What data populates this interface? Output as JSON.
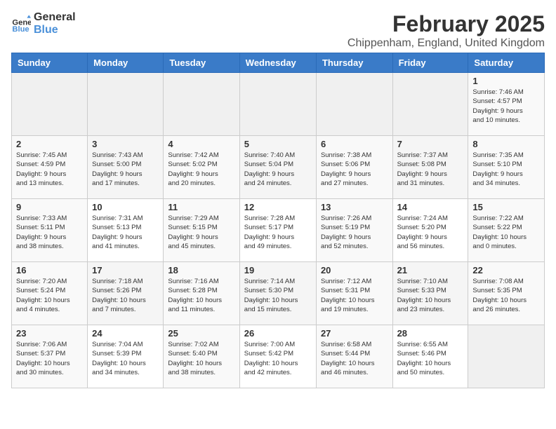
{
  "header": {
    "logo_line1": "General",
    "logo_line2": "Blue",
    "month_year": "February 2025",
    "location": "Chippenham, England, United Kingdom"
  },
  "weekdays": [
    "Sunday",
    "Monday",
    "Tuesday",
    "Wednesday",
    "Thursday",
    "Friday",
    "Saturday"
  ],
  "weeks": [
    [
      {
        "day": "",
        "info": ""
      },
      {
        "day": "",
        "info": ""
      },
      {
        "day": "",
        "info": ""
      },
      {
        "day": "",
        "info": ""
      },
      {
        "day": "",
        "info": ""
      },
      {
        "day": "",
        "info": ""
      },
      {
        "day": "1",
        "info": "Sunrise: 7:46 AM\nSunset: 4:57 PM\nDaylight: 9 hours\nand 10 minutes."
      }
    ],
    [
      {
        "day": "2",
        "info": "Sunrise: 7:45 AM\nSunset: 4:59 PM\nDaylight: 9 hours\nand 13 minutes."
      },
      {
        "day": "3",
        "info": "Sunrise: 7:43 AM\nSunset: 5:00 PM\nDaylight: 9 hours\nand 17 minutes."
      },
      {
        "day": "4",
        "info": "Sunrise: 7:42 AM\nSunset: 5:02 PM\nDaylight: 9 hours\nand 20 minutes."
      },
      {
        "day": "5",
        "info": "Sunrise: 7:40 AM\nSunset: 5:04 PM\nDaylight: 9 hours\nand 24 minutes."
      },
      {
        "day": "6",
        "info": "Sunrise: 7:38 AM\nSunset: 5:06 PM\nDaylight: 9 hours\nand 27 minutes."
      },
      {
        "day": "7",
        "info": "Sunrise: 7:37 AM\nSunset: 5:08 PM\nDaylight: 9 hours\nand 31 minutes."
      },
      {
        "day": "8",
        "info": "Sunrise: 7:35 AM\nSunset: 5:10 PM\nDaylight: 9 hours\nand 34 minutes."
      }
    ],
    [
      {
        "day": "9",
        "info": "Sunrise: 7:33 AM\nSunset: 5:11 PM\nDaylight: 9 hours\nand 38 minutes."
      },
      {
        "day": "10",
        "info": "Sunrise: 7:31 AM\nSunset: 5:13 PM\nDaylight: 9 hours\nand 41 minutes."
      },
      {
        "day": "11",
        "info": "Sunrise: 7:29 AM\nSunset: 5:15 PM\nDaylight: 9 hours\nand 45 minutes."
      },
      {
        "day": "12",
        "info": "Sunrise: 7:28 AM\nSunset: 5:17 PM\nDaylight: 9 hours\nand 49 minutes."
      },
      {
        "day": "13",
        "info": "Sunrise: 7:26 AM\nSunset: 5:19 PM\nDaylight: 9 hours\nand 52 minutes."
      },
      {
        "day": "14",
        "info": "Sunrise: 7:24 AM\nSunset: 5:20 PM\nDaylight: 9 hours\nand 56 minutes."
      },
      {
        "day": "15",
        "info": "Sunrise: 7:22 AM\nSunset: 5:22 PM\nDaylight: 10 hours\nand 0 minutes."
      }
    ],
    [
      {
        "day": "16",
        "info": "Sunrise: 7:20 AM\nSunset: 5:24 PM\nDaylight: 10 hours\nand 4 minutes."
      },
      {
        "day": "17",
        "info": "Sunrise: 7:18 AM\nSunset: 5:26 PM\nDaylight: 10 hours\nand 7 minutes."
      },
      {
        "day": "18",
        "info": "Sunrise: 7:16 AM\nSunset: 5:28 PM\nDaylight: 10 hours\nand 11 minutes."
      },
      {
        "day": "19",
        "info": "Sunrise: 7:14 AM\nSunset: 5:30 PM\nDaylight: 10 hours\nand 15 minutes."
      },
      {
        "day": "20",
        "info": "Sunrise: 7:12 AM\nSunset: 5:31 PM\nDaylight: 10 hours\nand 19 minutes."
      },
      {
        "day": "21",
        "info": "Sunrise: 7:10 AM\nSunset: 5:33 PM\nDaylight: 10 hours\nand 23 minutes."
      },
      {
        "day": "22",
        "info": "Sunrise: 7:08 AM\nSunset: 5:35 PM\nDaylight: 10 hours\nand 26 minutes."
      }
    ],
    [
      {
        "day": "23",
        "info": "Sunrise: 7:06 AM\nSunset: 5:37 PM\nDaylight: 10 hours\nand 30 minutes."
      },
      {
        "day": "24",
        "info": "Sunrise: 7:04 AM\nSunset: 5:39 PM\nDaylight: 10 hours\nand 34 minutes."
      },
      {
        "day": "25",
        "info": "Sunrise: 7:02 AM\nSunset: 5:40 PM\nDaylight: 10 hours\nand 38 minutes."
      },
      {
        "day": "26",
        "info": "Sunrise: 7:00 AM\nSunset: 5:42 PM\nDaylight: 10 hours\nand 42 minutes."
      },
      {
        "day": "27",
        "info": "Sunrise: 6:58 AM\nSunset: 5:44 PM\nDaylight: 10 hours\nand 46 minutes."
      },
      {
        "day": "28",
        "info": "Sunrise: 6:55 AM\nSunset: 5:46 PM\nDaylight: 10 hours\nand 50 minutes."
      },
      {
        "day": "",
        "info": ""
      }
    ]
  ]
}
